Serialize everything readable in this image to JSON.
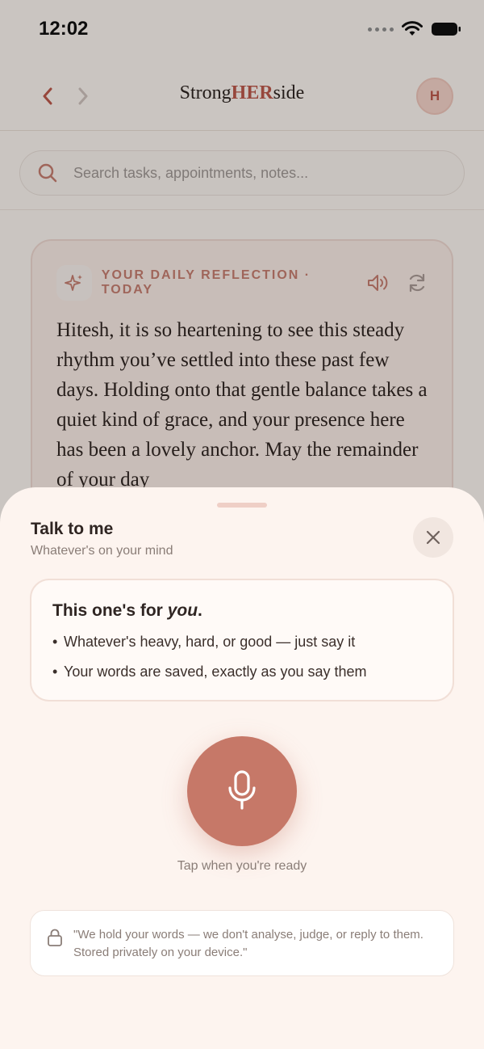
{
  "status_bar": {
    "time": "12:02"
  },
  "header": {
    "brand_prefix": "Strong",
    "brand_highlight": "HER",
    "brand_suffix": "side",
    "avatar_initial": "H"
  },
  "search": {
    "placeholder": "Search tasks, appointments, notes..."
  },
  "reflection": {
    "label": "YOUR DAILY REFLECTION · TODAY",
    "body": "Hitesh, it is so heartening to see this steady rhythm you’ve settled into these past few days. Holding onto that gentle balance takes a quiet kind of grace, and your presence here has been a lovely anchor. May the remainder of your day"
  },
  "sheet": {
    "title": "Talk to me",
    "subtitle": "Whatever's on your mind",
    "card": {
      "title_prefix": "This one's for ",
      "title_emphasis": "you",
      "title_suffix": ".",
      "bullets": [
        "Whatever's heavy, hard, or good — just say it",
        "Your words are saved, exactly as you say them"
      ]
    },
    "mic_caption": "Tap when you're ready",
    "privacy_note": "\"We hold your words — we don't analyse, judge, or reply to them. Stored privately on your device.\""
  },
  "colors": {
    "accent": "#c67868",
    "brand_highlight": "#b9574a",
    "sheet_background": "#fdf4ef"
  },
  "icons": [
    "back-chevron-icon",
    "forward-chevron-icon",
    "search-icon",
    "sparkle-icon",
    "speaker-icon",
    "refresh-icon",
    "close-icon",
    "microphone-icon",
    "lock-icon",
    "wifi-icon",
    "battery-icon"
  ]
}
